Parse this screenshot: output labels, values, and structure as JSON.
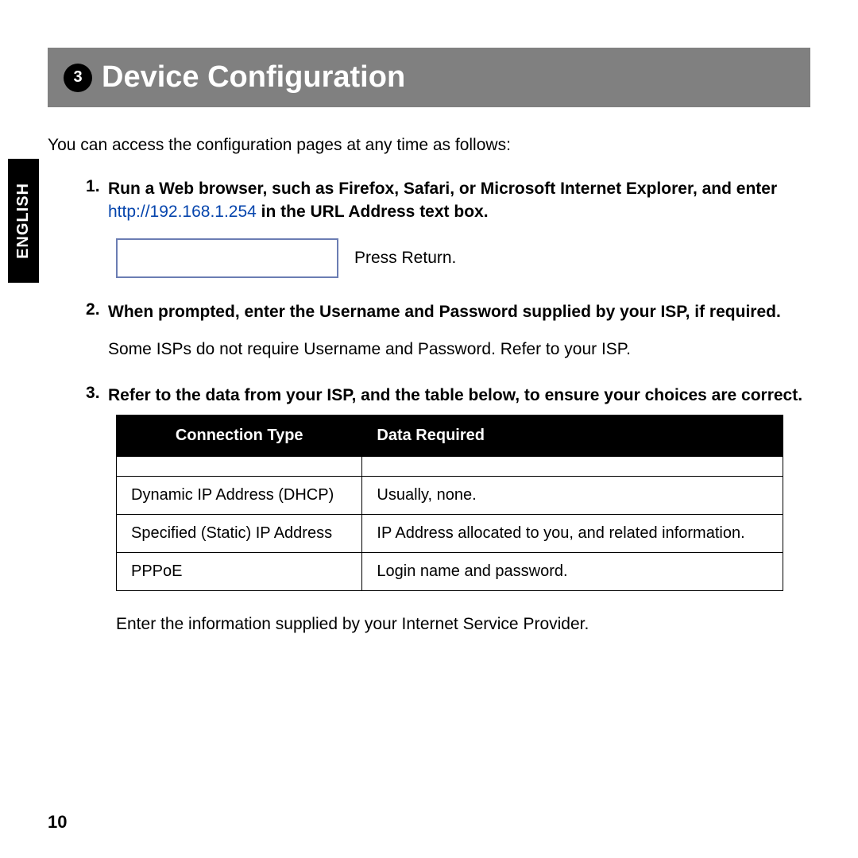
{
  "header": {
    "step_number": "3",
    "title": "Device Configuration"
  },
  "language_tab": "ENGLISH",
  "intro": "You can access the configuration pages at any time as follows:",
  "steps": {
    "s1": {
      "head_before": "Run a Web browser, such as Firefox, Safari, or Microsoft Internet Explorer, and enter ",
      "url": "http://192.168.1.254",
      "head_after": " in the URL Address text box.",
      "press_return": "Press Return."
    },
    "s2": {
      "head": "When prompted, enter the Username and Password supplied by your ISP, if required.",
      "sub": "Some ISPs do not require Username and Password. Refer to your ISP."
    },
    "s3": {
      "head": "Refer to the data from your ISP, and the table below, to ensure your choices are correct."
    }
  },
  "table": {
    "headers": {
      "col1": "Connection Type",
      "col2": "Data Required"
    },
    "rows": [
      {
        "col1": "Dynamic IP Address (DHCP)",
        "col2": "Usually, none."
      },
      {
        "col1": "Specified (Static) IP Address",
        "col2": "IP Address allocated to you, and related information."
      },
      {
        "col1": "PPPoE",
        "col2": "Login name and password."
      }
    ]
  },
  "closing": "Enter the information supplied by your Internet Service Provider.",
  "page_number": "10"
}
